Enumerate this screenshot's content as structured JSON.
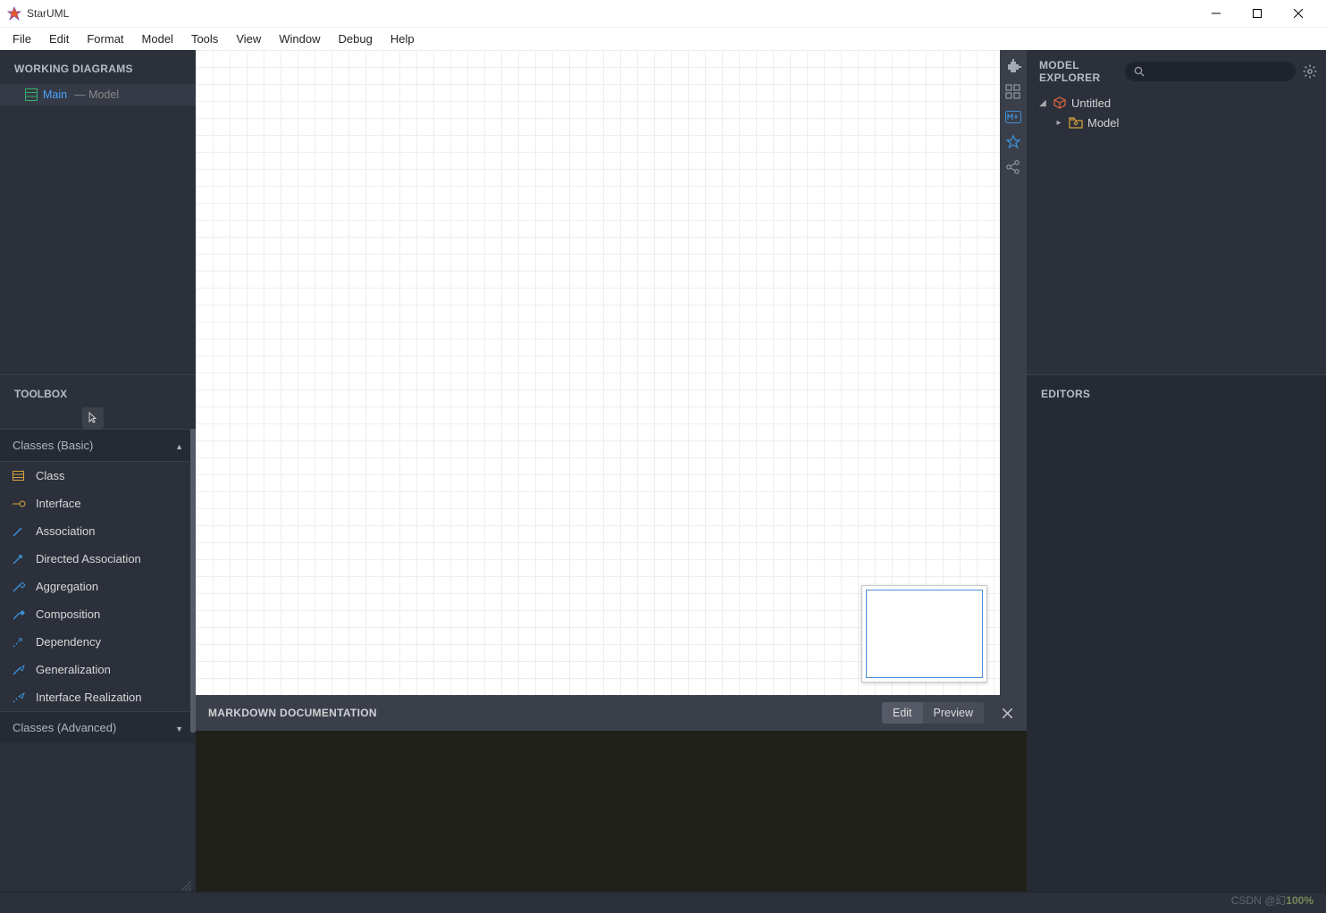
{
  "window": {
    "title": "StarUML"
  },
  "menu": [
    "File",
    "Edit",
    "Format",
    "Model",
    "Tools",
    "View",
    "Window",
    "Debug",
    "Help"
  ],
  "workingDiagrams": {
    "title": "WORKING DIAGRAMS",
    "items": [
      {
        "name": "Main",
        "suffix": "— Model"
      }
    ]
  },
  "toolbox": {
    "title": "TOOLBOX",
    "groupBasic": "Classes (Basic)",
    "groupAdvanced": "Classes (Advanced)",
    "items": [
      {
        "label": "Class",
        "icon": "class"
      },
      {
        "label": "Interface",
        "icon": "interface"
      },
      {
        "label": "Association",
        "icon": "association"
      },
      {
        "label": "Directed Association",
        "icon": "directed-association"
      },
      {
        "label": "Aggregation",
        "icon": "aggregation"
      },
      {
        "label": "Composition",
        "icon": "composition"
      },
      {
        "label": "Dependency",
        "icon": "dependency"
      },
      {
        "label": "Generalization",
        "icon": "generalization"
      },
      {
        "label": "Interface Realization",
        "icon": "interface-realization"
      }
    ]
  },
  "markdown": {
    "title": "MARKDOWN DOCUMENTATION",
    "edit": "Edit",
    "preview": "Preview"
  },
  "modelExplorer": {
    "title": "MODEL EXPLORER",
    "searchPlaceholder": "",
    "tree": {
      "root": "Untitled",
      "child": "Model"
    }
  },
  "editors": {
    "title": "EDITORS"
  },
  "watermark": {
    "prefix": "CSDN @幻",
    "zoom": "100%"
  }
}
